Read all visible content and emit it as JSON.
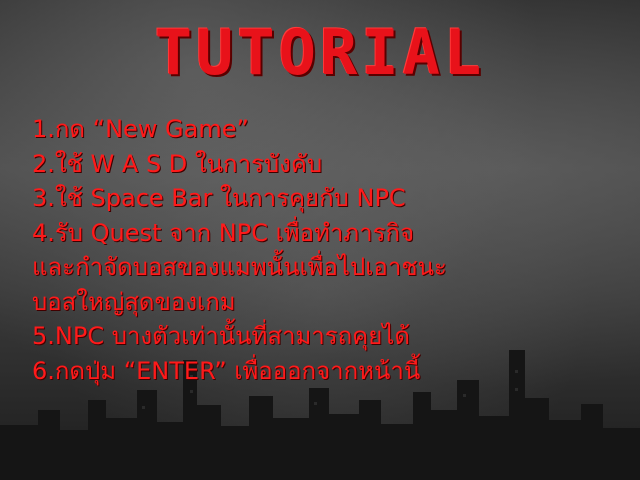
{
  "screen": {
    "title": "TUTORIAL",
    "lines": [
      "1.กด “New Game”",
      "2.ใช้ W A S D ในการบังคับ",
      "3.ใช้ Space Bar ในการคุยกับ NPC",
      "4.รับ Quest จาก NPC เพื่อทำภารกิจ",
      "และกำจัดบอสของแมพนั้นเพื่อไปเอาชนะ",
      "บอสใหญ่สุดของเกม",
      "5.NPC บางตัวเท่านั้นที่สามารถคุยได้",
      "6.กดปุ่ม “ENTER” เพื่อออกจากหน้านี้"
    ]
  },
  "colors": {
    "text": "#ff1a1a",
    "title": "#e8121a",
    "sky": "#3b3b3b"
  }
}
